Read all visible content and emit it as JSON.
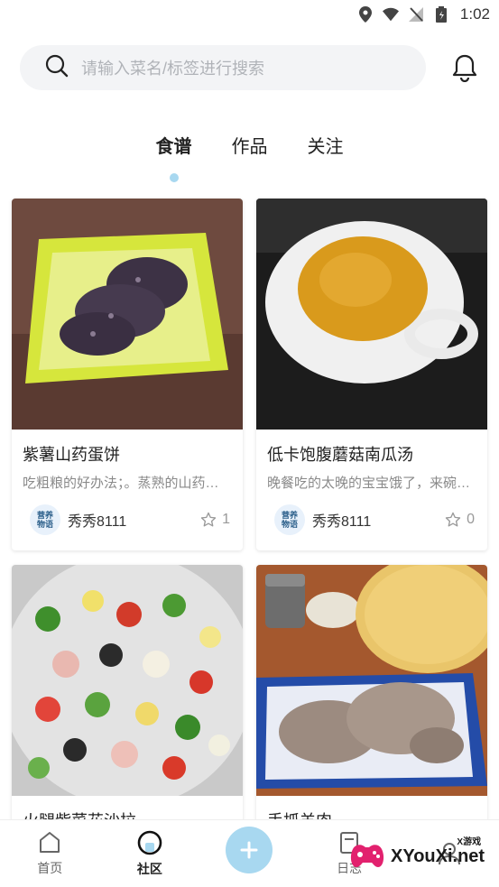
{
  "status_bar": {
    "time": "1:02"
  },
  "search": {
    "placeholder": "请输入菜名/标签进行搜索"
  },
  "tabs": [
    {
      "label": "食谱",
      "active": true
    },
    {
      "label": "作品",
      "active": false
    },
    {
      "label": "关注",
      "active": false
    }
  ],
  "cards": [
    {
      "title": "紫薯山药蛋饼",
      "desc": "吃粗粮的好办法；。蒸熟的山药和紫薯…",
      "author": "秀秀8111",
      "likes": "1",
      "avatar_text": [
        "营养",
        "物语"
      ]
    },
    {
      "title": "低卡饱腹蘑菇南瓜汤",
      "desc": "晚餐吃的太晚的宝宝饿了，来碗…",
      "author": "秀秀8111",
      "likes": "0",
      "avatar_text": [
        "营养",
        "物语"
      ]
    },
    {
      "title": "火腿紫菜花沙拉",
      "desc": "",
      "author": "",
      "likes": ""
    },
    {
      "title": "手抓羊肉",
      "desc": "",
      "author": "",
      "likes": ""
    }
  ],
  "bottom_nav": [
    {
      "label": "首页",
      "icon": "home-icon"
    },
    {
      "label": "社区",
      "icon": "community-icon",
      "active": true
    },
    {
      "label": "",
      "icon": "add-icon"
    },
    {
      "label": "日志",
      "icon": "diary-icon"
    },
    {
      "label": "",
      "icon": "profile-icon"
    }
  ],
  "watermark": {
    "text": "XYouXi.net",
    "small": "X游戏"
  },
  "colors": {
    "accent": "#a8d8f0",
    "background": "#ffffff",
    "search_bg": "#f3f4f6"
  }
}
